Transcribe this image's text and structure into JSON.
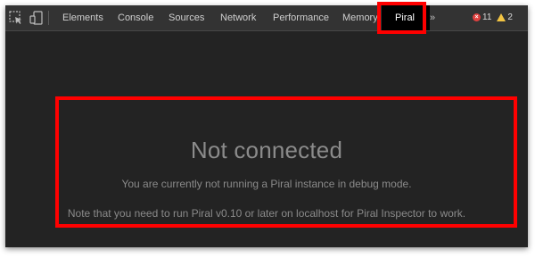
{
  "toolbar": {
    "icons": [
      "element-picker-icon",
      "device-toggle-icon"
    ],
    "tabs": [
      {
        "label": "Elements"
      },
      {
        "label": "Console"
      },
      {
        "label": "Sources"
      },
      {
        "label": "Network"
      },
      {
        "label": "Performance"
      },
      {
        "label": "Memory"
      },
      {
        "label": "Piral",
        "active": true
      }
    ],
    "overflow": "»",
    "status": {
      "errors": "11",
      "warnings": "2",
      "error_color": "#e0413f",
      "warning_color": "#f2c443"
    }
  },
  "panel": {
    "title": "Not connected",
    "message": "You are currently not running a Piral instance in debug mode.",
    "note": "Note that you need to run Piral v0.10 or later on localhost for Piral Inspector to work."
  },
  "highlight_color": "#ff0000"
}
